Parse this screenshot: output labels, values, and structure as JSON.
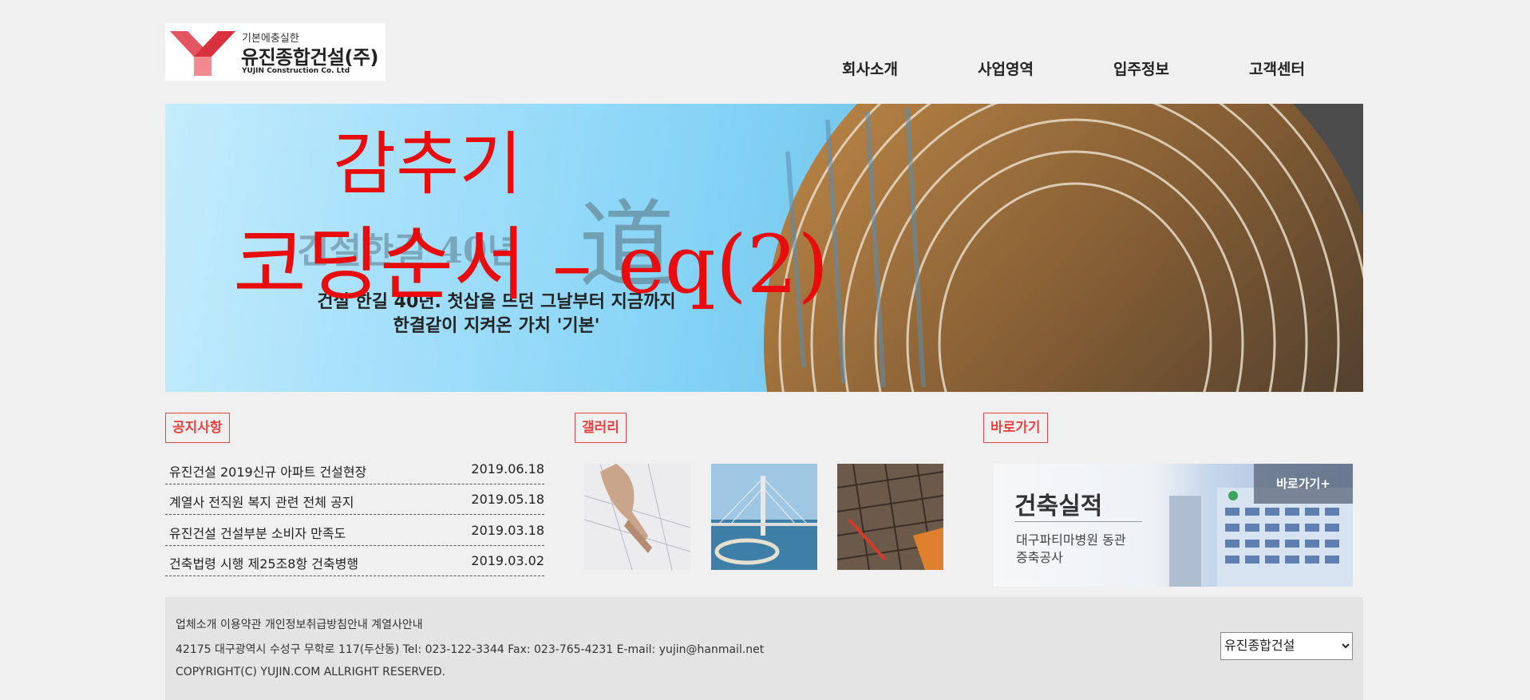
{
  "header": {
    "logo": {
      "tagline": "기본에충실한",
      "name": "유진종합건설(주)",
      "english": "YUJIN Construction Co. Ltd"
    },
    "nav": [
      "회사소개",
      "사업영역",
      "입주정보",
      "고객센터"
    ]
  },
  "hero": {
    "ghost_title": "건설한길 40년",
    "ghost_char": "道",
    "subtitle_line1": "건설 한길 40년. 첫삽을 뜨던 그날부터 지금까지",
    "subtitle_line2": "한결같이 지켜온 가치 '기본'",
    "watermark_line1": "감추기",
    "watermark_line2": "코딩순서 – eq(2)"
  },
  "notice": {
    "label": "공지사항",
    "items": [
      {
        "title": "유진건설 2019신규 아파트 건설현장",
        "date": "2019.06.18"
      },
      {
        "title": "계열사 전직원 복지 관련 전체 공지",
        "date": "2019.05.18"
      },
      {
        "title": "유진건설 건설부분 소비자 만족도",
        "date": "2019.03.18"
      },
      {
        "title": "건축법령 시행 제25조8항 건축병행",
        "date": "2019.03.02"
      }
    ]
  },
  "gallery": {
    "label": "갤러리",
    "images": [
      "blueprint-hands-image",
      "bridge-image",
      "construction-site-image"
    ]
  },
  "shortcut": {
    "label": "바로가기",
    "banner_title": "건축실적",
    "banner_line1": "대구파티마병원 동관",
    "banner_line2": "증축공사",
    "banner_button": "바로가기+"
  },
  "footer": {
    "links": "업체소개 이용약관 개인정보취급방침안내 계열사안내",
    "address": "42175 대구광역시 수성구 무학로 117(두산동) Tel: 023-122-3344 Fax: 023-765-4231 E-mail: yujin@hanmail.net",
    "copyright": "COPYRIGHT(C) YUJIN.COM ALLRIGHT RESERVED.",
    "family_select": "유진종합건설"
  },
  "colors": {
    "accent": "#e34444",
    "watermark": "#e80c0c",
    "footer_bg": "#e4e4e4"
  }
}
